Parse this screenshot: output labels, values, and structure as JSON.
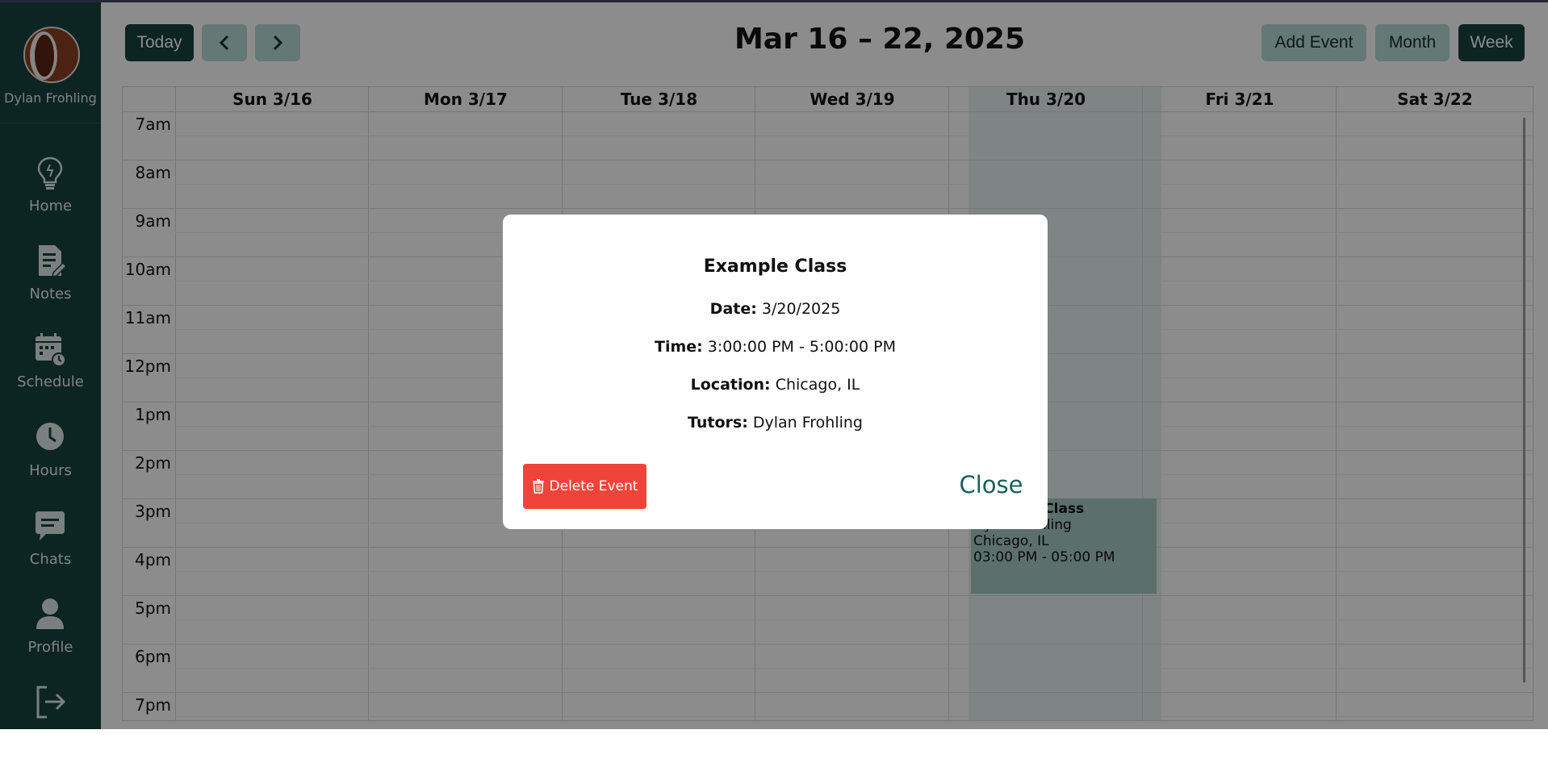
{
  "sidebar": {
    "user_name": "Dylan Frohling",
    "items": [
      {
        "label": "Home",
        "icon": "lightbulb-icon"
      },
      {
        "label": "Notes",
        "icon": "notes-icon"
      },
      {
        "label": "Schedule",
        "icon": "calendar-clock-icon"
      },
      {
        "label": "Hours",
        "icon": "clock-icon"
      },
      {
        "label": "Chats",
        "icon": "chat-bubble-icon"
      },
      {
        "label": "Profile",
        "icon": "user-icon"
      },
      {
        "label": "",
        "icon": "logout-icon"
      }
    ]
  },
  "toolbar": {
    "today_label": "Today",
    "prev_icon": "chevron-left-icon",
    "next_icon": "chevron-right-icon",
    "title": "Mar 16 – 22, 2025",
    "add_event_label": "Add Event",
    "month_label": "Month",
    "week_label": "Week"
  },
  "calendar": {
    "days": [
      "Sun 3/16",
      "Mon 3/17",
      "Tue 3/18",
      "Wed 3/19",
      "Thu 3/20",
      "Fri 3/21",
      "Sat 3/22"
    ],
    "hours": [
      "7am",
      "8am",
      "9am",
      "10am",
      "11am",
      "12pm",
      "1pm",
      "2pm",
      "3pm",
      "4pm",
      "5pm",
      "6pm",
      "7pm"
    ],
    "event": {
      "title": "Example Class",
      "tutor": "Dylan Frohling",
      "location": "Chicago, IL",
      "time": "03:00 PM - 05:00 PM"
    }
  },
  "modal": {
    "title": "Example Class",
    "date_label": "Date:",
    "date_value": "3/20/2025",
    "time_label": "Time:",
    "time_value": "3:00:00 PM - 5:00:00 PM",
    "location_label": "Location:",
    "location_value": "Chicago, IL",
    "tutors_label": "Tutors:",
    "tutors_value": "Dylan Frohling",
    "delete_label": "Delete Event",
    "close_label": "Close"
  },
  "colors": {
    "sidebar_bg": "#17423f",
    "accent_light": "#b6dbd6",
    "today_column": "#e6f2f1",
    "event_bg": "#a6cac5",
    "delete_red": "#f0443a",
    "close_text": "#17615a"
  }
}
